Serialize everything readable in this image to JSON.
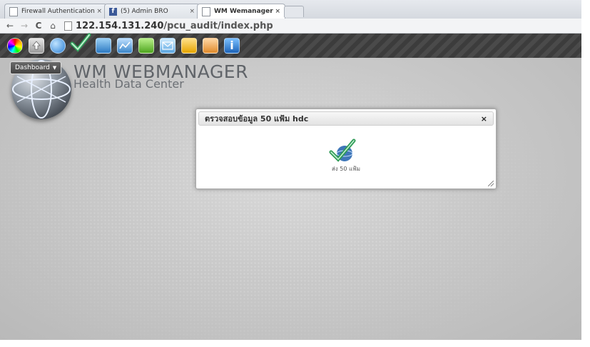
{
  "browser": {
    "tabs": [
      {
        "label": "Firewall Authentication",
        "icon": "page-icon",
        "active": false
      },
      {
        "label": "(5) Admin BRO",
        "icon": "facebook-icon",
        "active": false
      },
      {
        "label": "WM Wemanager",
        "icon": "page-icon",
        "active": true
      }
    ],
    "tab_close": "×",
    "url_host": "122.154.131.240",
    "url_path": "/pcu_audit/index.php",
    "nav": {
      "back": "←",
      "forward": "→",
      "reload": "C",
      "home": "⌂"
    }
  },
  "app": {
    "brand_title": "WM WEBMANAGER",
    "brand_subtitle": "Health Data Center",
    "dashboard_label": "Dashboard",
    "menu_icons": [
      "color-wheel-icon",
      "upload-icon",
      "globe-icon",
      "checkmark-icon",
      "settings-icon",
      "chart-icon",
      "sms-icon",
      "mail-icon",
      "users-icon",
      "user-icon",
      "info-icon"
    ],
    "colors": {
      "menubar": "#3c3c3c",
      "background": "#c9c9c9"
    }
  },
  "dialog": {
    "title": "ตรวจสอบข้อมูล 50 แฟ้ม hdc",
    "close": "×",
    "icon": "checkmark-globe-icon",
    "action_label": "ส่ง 50 แฟ้ม"
  }
}
